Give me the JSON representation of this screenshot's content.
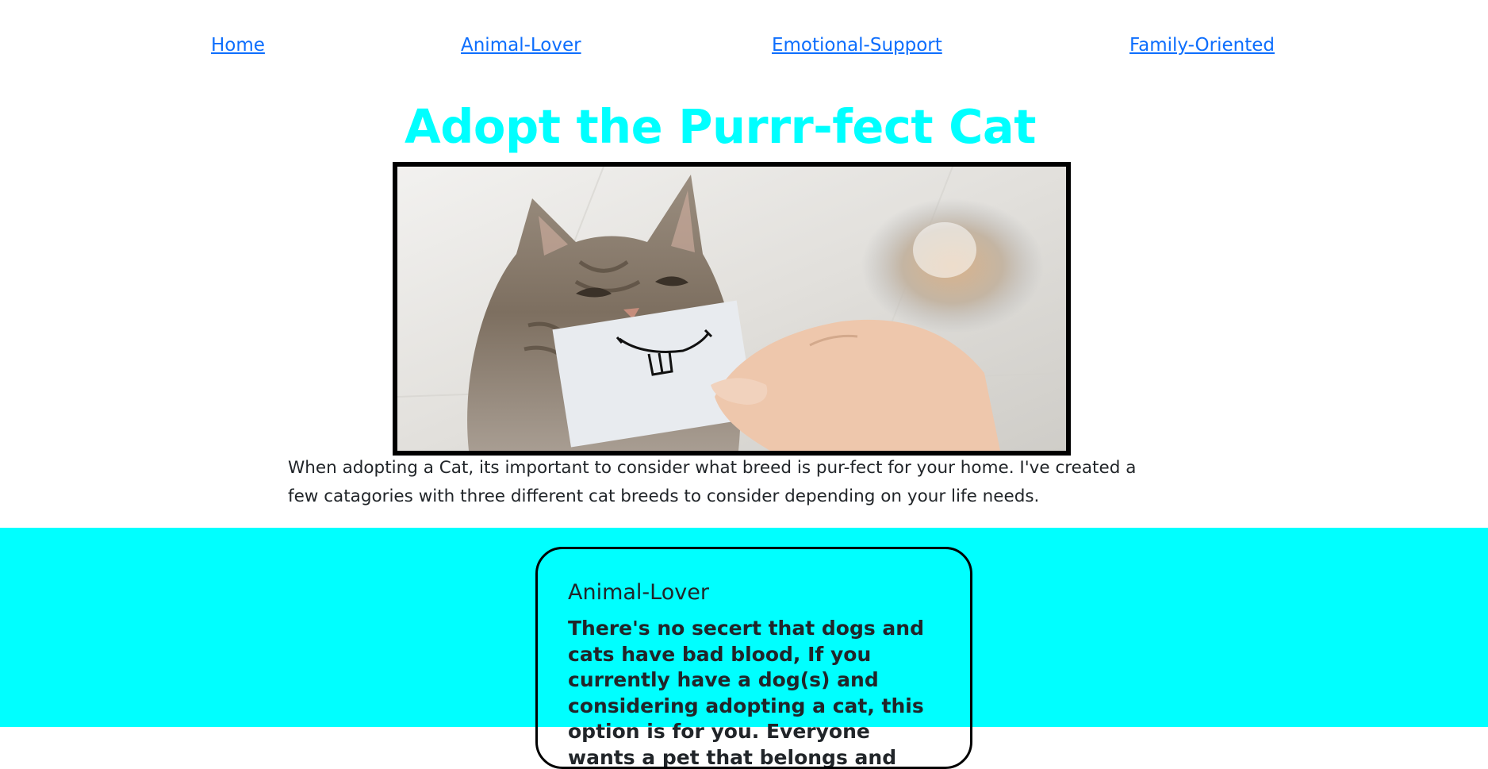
{
  "nav": {
    "links": [
      {
        "label": "Home"
      },
      {
        "label": "Animal-Lover"
      },
      {
        "label": "Emotional-Support"
      },
      {
        "label": "Family-Oriented"
      }
    ]
  },
  "header": {
    "title": "Adopt the Purrr-fect Cat"
  },
  "hero": {
    "image_subject": "smiling kitten behind paper card with drawn buck-tooth smile"
  },
  "intro": {
    "text": "When adopting a Cat, its important to consider what breed is pur-fect for your home. I've created a few catagories with three different cat breeds to consider depending on your life needs."
  },
  "cards": [
    {
      "heading": "Animal-Lover",
      "body": "There's no secert that dogs and cats have bad blood, If you currently have a dog(s) and considering adopting a cat, this option is for you. Everyone wants a pet that belongs and they"
    }
  ],
  "colors": {
    "accent": "#00ffff",
    "link": "#0d6efd",
    "text": "#212529"
  }
}
